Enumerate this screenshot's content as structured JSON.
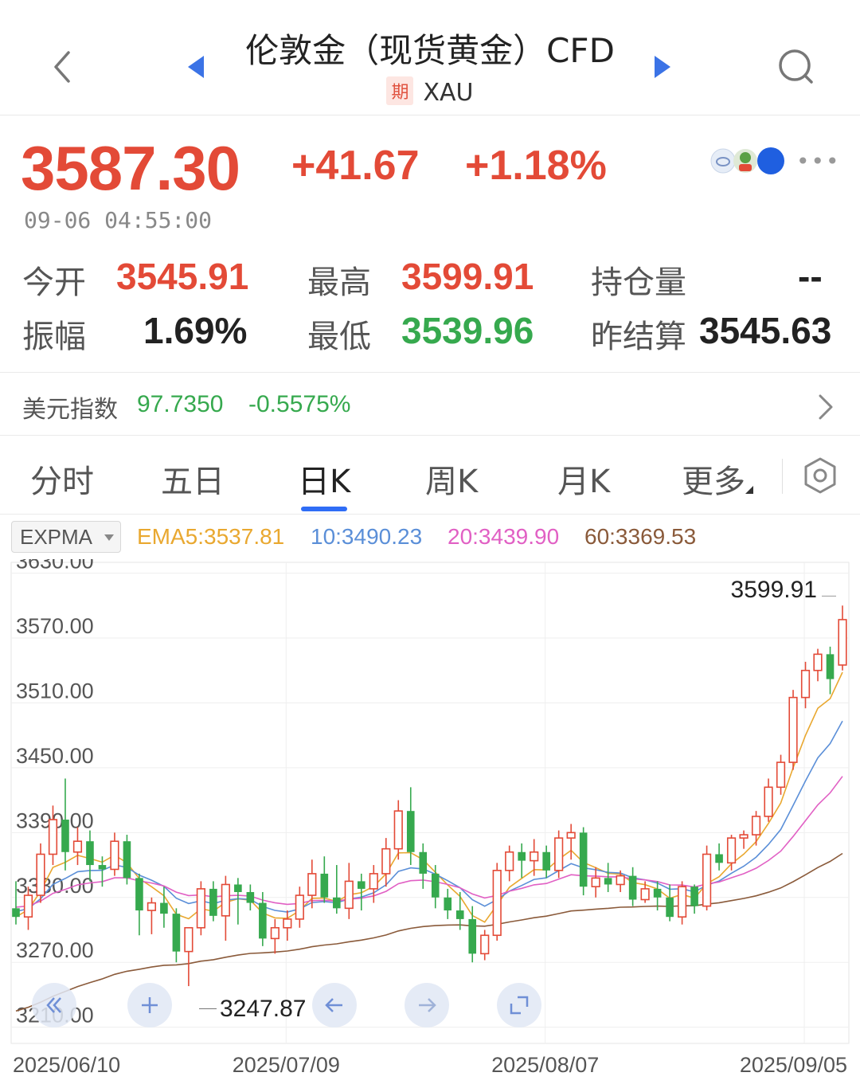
{
  "header": {
    "title": "伦敦金（现货黄金）CFD",
    "badge": "期",
    "symbol": "XAU"
  },
  "quote": {
    "price": "3587.30",
    "change": "+41.67",
    "change_pct": "+1.18%",
    "timestamp": "09-06 04:55:00",
    "stats": {
      "open_label": "今开",
      "open": "3545.91",
      "high_label": "最高",
      "high": "3599.91",
      "oi_label": "持仓量",
      "oi": "--",
      "amp_label": "振幅",
      "amp": "1.69%",
      "low_label": "最低",
      "low": "3539.96",
      "prev_label": "昨结算",
      "prev": "3545.63"
    },
    "colors": {
      "up": "#e34a37",
      "down": "#36a94e"
    }
  },
  "usd_index": {
    "label": "美元指数",
    "value": "97.7350",
    "change": "-0.5575%"
  },
  "tabs": [
    "分时",
    "五日",
    "日K",
    "周K",
    "月K",
    "更多"
  ],
  "active_tab": "日K",
  "indicators": {
    "select": "EXPMA",
    "ema5": "EMA5:3537.81",
    "ema10": "10:3490.23",
    "ema20": "20:3439.90",
    "ema60": "60:3369.53",
    "colors": {
      "ema5": "#e9a830",
      "ema10": "#5b8fd8",
      "ema20": "#e160c4",
      "ema60": "#8a5a3a"
    }
  },
  "chart_data": {
    "type": "candlestick",
    "y_ticks": [
      "3630.00",
      "3570.00",
      "3510.00",
      "3450.00",
      "3390.00",
      "3330.00",
      "3270.00",
      "3210.00"
    ],
    "ylim": [
      3195,
      3640
    ],
    "x_tick_labels": [
      "2025/06/10",
      "2025/07/09",
      "2025/08/07",
      "2025/09/05"
    ],
    "x_tick_index": [
      0,
      21,
      42,
      63
    ],
    "high_marker": "3599.91",
    "low_marker": "3247.87",
    "candles": [
      {
        "o": 3320,
        "h": 3345,
        "l": 3305,
        "c": 3312
      },
      {
        "o": 3312,
        "h": 3340,
        "l": 3300,
        "c": 3332
      },
      {
        "o": 3332,
        "h": 3380,
        "l": 3325,
        "c": 3370
      },
      {
        "o": 3370,
        "h": 3415,
        "l": 3360,
        "c": 3402
      },
      {
        "o": 3402,
        "h": 3440,
        "l": 3355,
        "c": 3372
      },
      {
        "o": 3372,
        "h": 3395,
        "l": 3360,
        "c": 3382
      },
      {
        "o": 3382,
        "h": 3392,
        "l": 3345,
        "c": 3360
      },
      {
        "o": 3360,
        "h": 3368,
        "l": 3340,
        "c": 3356
      },
      {
        "o": 3356,
        "h": 3390,
        "l": 3350,
        "c": 3382
      },
      {
        "o": 3382,
        "h": 3388,
        "l": 3342,
        "c": 3348
      },
      {
        "o": 3348,
        "h": 3352,
        "l": 3295,
        "c": 3318
      },
      {
        "o": 3318,
        "h": 3330,
        "l": 3296,
        "c": 3325
      },
      {
        "o": 3325,
        "h": 3340,
        "l": 3302,
        "c": 3315
      },
      {
        "o": 3315,
        "h": 3320,
        "l": 3270,
        "c": 3280
      },
      {
        "o": 3280,
        "h": 3295,
        "l": 3248,
        "c": 3302
      },
      {
        "o": 3302,
        "h": 3345,
        "l": 3295,
        "c": 3338
      },
      {
        "o": 3338,
        "h": 3345,
        "l": 3308,
        "c": 3313
      },
      {
        "o": 3313,
        "h": 3350,
        "l": 3290,
        "c": 3342
      },
      {
        "o": 3342,
        "h": 3348,
        "l": 3305,
        "c": 3335
      },
      {
        "o": 3335,
        "h": 3342,
        "l": 3318,
        "c": 3325
      },
      {
        "o": 3325,
        "h": 3335,
        "l": 3285,
        "c": 3292
      },
      {
        "o": 3292,
        "h": 3310,
        "l": 3278,
        "c": 3302
      },
      {
        "o": 3302,
        "h": 3318,
        "l": 3290,
        "c": 3310
      },
      {
        "o": 3310,
        "h": 3340,
        "l": 3302,
        "c": 3332
      },
      {
        "o": 3332,
        "h": 3365,
        "l": 3320,
        "c": 3352
      },
      {
        "o": 3352,
        "h": 3368,
        "l": 3325,
        "c": 3330
      },
      {
        "o": 3330,
        "h": 3360,
        "l": 3315,
        "c": 3320
      },
      {
        "o": 3320,
        "h": 3362,
        "l": 3310,
        "c": 3345
      },
      {
        "o": 3345,
        "h": 3352,
        "l": 3318,
        "c": 3338
      },
      {
        "o": 3338,
        "h": 3360,
        "l": 3325,
        "c": 3352
      },
      {
        "o": 3352,
        "h": 3385,
        "l": 3340,
        "c": 3375
      },
      {
        "o": 3375,
        "h": 3420,
        "l": 3365,
        "c": 3410
      },
      {
        "o": 3410,
        "h": 3432,
        "l": 3360,
        "c": 3372
      },
      {
        "o": 3372,
        "h": 3380,
        "l": 3338,
        "c": 3352
      },
      {
        "o": 3352,
        "h": 3360,
        "l": 3320,
        "c": 3330
      },
      {
        "o": 3330,
        "h": 3338,
        "l": 3310,
        "c": 3318
      },
      {
        "o": 3318,
        "h": 3335,
        "l": 3300,
        "c": 3310
      },
      {
        "o": 3310,
        "h": 3322,
        "l": 3270,
        "c": 3278
      },
      {
        "o": 3278,
        "h": 3300,
        "l": 3272,
        "c": 3295
      },
      {
        "o": 3295,
        "h": 3362,
        "l": 3290,
        "c": 3355
      },
      {
        "o": 3355,
        "h": 3378,
        "l": 3345,
        "c": 3372
      },
      {
        "o": 3372,
        "h": 3380,
        "l": 3348,
        "c": 3364
      },
      {
        "o": 3364,
        "h": 3384,
        "l": 3350,
        "c": 3372
      },
      {
        "o": 3372,
        "h": 3378,
        "l": 3348,
        "c": 3355
      },
      {
        "o": 3355,
        "h": 3392,
        "l": 3348,
        "c": 3385
      },
      {
        "o": 3385,
        "h": 3398,
        "l": 3365,
        "c": 3390
      },
      {
        "o": 3390,
        "h": 3395,
        "l": 3332,
        "c": 3340
      },
      {
        "o": 3340,
        "h": 3358,
        "l": 3330,
        "c": 3348
      },
      {
        "o": 3348,
        "h": 3362,
        "l": 3335,
        "c": 3342
      },
      {
        "o": 3342,
        "h": 3355,
        "l": 3335,
        "c": 3350
      },
      {
        "o": 3350,
        "h": 3358,
        "l": 3322,
        "c": 3328
      },
      {
        "o": 3328,
        "h": 3345,
        "l": 3325,
        "c": 3338
      },
      {
        "o": 3338,
        "h": 3345,
        "l": 3318,
        "c": 3330
      },
      {
        "o": 3330,
        "h": 3342,
        "l": 3308,
        "c": 3312
      },
      {
        "o": 3312,
        "h": 3345,
        "l": 3305,
        "c": 3340
      },
      {
        "o": 3340,
        "h": 3342,
        "l": 3315,
        "c": 3322
      },
      {
        "o": 3322,
        "h": 3378,
        "l": 3318,
        "c": 3370
      },
      {
        "o": 3370,
        "h": 3380,
        "l": 3355,
        "c": 3362
      },
      {
        "o": 3362,
        "h": 3388,
        "l": 3355,
        "c": 3385
      },
      {
        "o": 3385,
        "h": 3392,
        "l": 3375,
        "c": 3388
      },
      {
        "o": 3388,
        "h": 3410,
        "l": 3378,
        "c": 3405
      },
      {
        "o": 3405,
        "h": 3440,
        "l": 3400,
        "c": 3432
      },
      {
        "o": 3432,
        "h": 3462,
        "l": 3425,
        "c": 3455
      },
      {
        "o": 3455,
        "h": 3522,
        "l": 3448,
        "c": 3515
      },
      {
        "o": 3515,
        "h": 3548,
        "l": 3505,
        "c": 3540
      },
      {
        "o": 3540,
        "h": 3560,
        "l": 3530,
        "c": 3555
      },
      {
        "o": 3555,
        "h": 3562,
        "l": 3518,
        "c": 3532
      },
      {
        "o": 3545,
        "h": 3600,
        "l": 3540,
        "c": 3587
      }
    ],
    "series": [
      {
        "name": "EMA5",
        "color": "#e9a830"
      },
      {
        "name": "10",
        "color": "#5b8fd8"
      },
      {
        "name": "20",
        "color": "#e160c4"
      },
      {
        "name": "60",
        "color": "#8a5a3a"
      }
    ]
  }
}
